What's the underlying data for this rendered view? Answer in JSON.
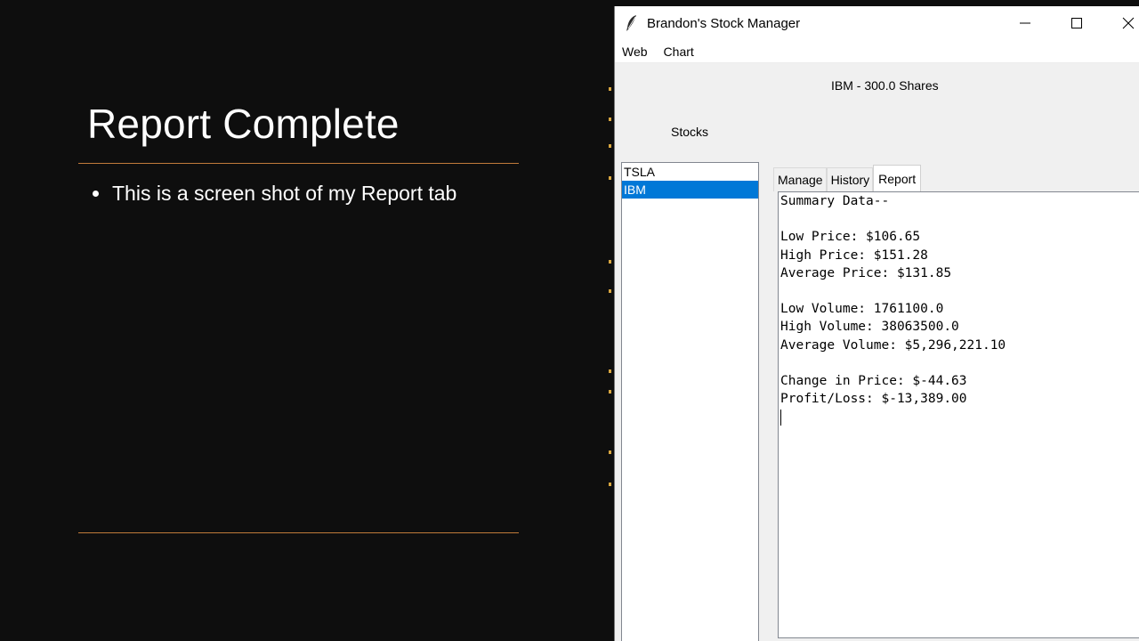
{
  "slide": {
    "title": "Report Complete",
    "bullets": [
      "This is a screen shot of my Report tab"
    ],
    "accent_color": "#c07a3a"
  },
  "window": {
    "title": "Brandon's Stock Manager",
    "icon": "feather-icon",
    "controls": [
      "minimize-icon",
      "maximize-icon",
      "close-icon"
    ],
    "menu": [
      "Web",
      "Chart"
    ],
    "header_label": "IBM - 300.0 Shares",
    "stocks_label": "Stocks",
    "stock_list": [
      "TSLA",
      "IBM"
    ],
    "selected_stock": "IBM",
    "selection_color": "#0078d7",
    "tabs": [
      "Manage",
      "History",
      "Report"
    ],
    "active_tab": "Report",
    "report_lines": [
      "Summary Data--",
      "",
      "Low Price: $106.65",
      "High Price: $151.28",
      "Average Price: $131.85",
      "",
      "Low Volume: 1761100.0",
      "High Volume: 38063500.0",
      "Average Volume: $5,296,221.10",
      "",
      "Change in Price: $-44.63",
      "Profit/Loss: $-13,389.00"
    ]
  }
}
